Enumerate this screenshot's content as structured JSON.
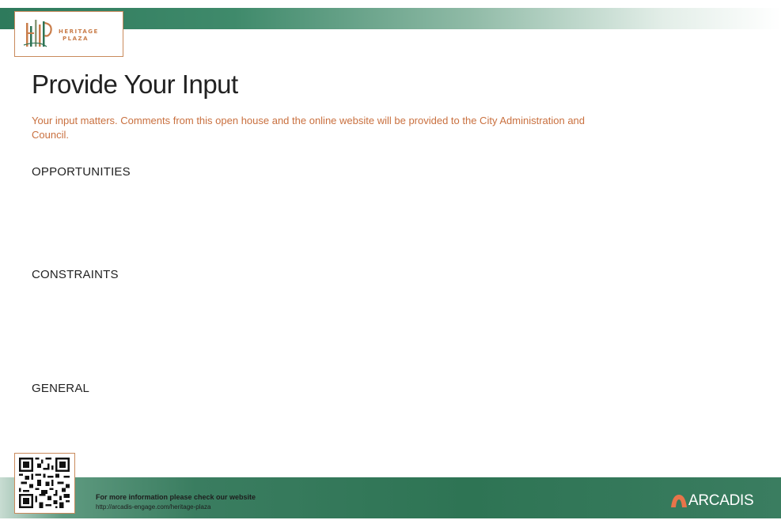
{
  "header": {
    "logo_line1": "HERITAGE",
    "logo_line2": "PLAZA"
  },
  "page": {
    "title": "Provide Your Input",
    "intro": "Your input matters. Comments from this open house and the online website will be provided to the City Administration and Council."
  },
  "sections": [
    {
      "label": "OPPORTUNITIES"
    },
    {
      "label": "CONSTRAINTS"
    },
    {
      "label": "GENERAL"
    }
  ],
  "footer": {
    "info_title": "For more information please check our website",
    "url": "http://arcadis-engage.com/heritage-plaza",
    "brand": "ARCADIS"
  },
  "colors": {
    "brand_green": "#2e7454",
    "accent_orange": "#c9703f",
    "heading": "#222222"
  },
  "icons": {
    "logo": "heritage-plaza-logo",
    "qr": "qr-code",
    "brand_mark": "arcadis-logo-mark"
  }
}
